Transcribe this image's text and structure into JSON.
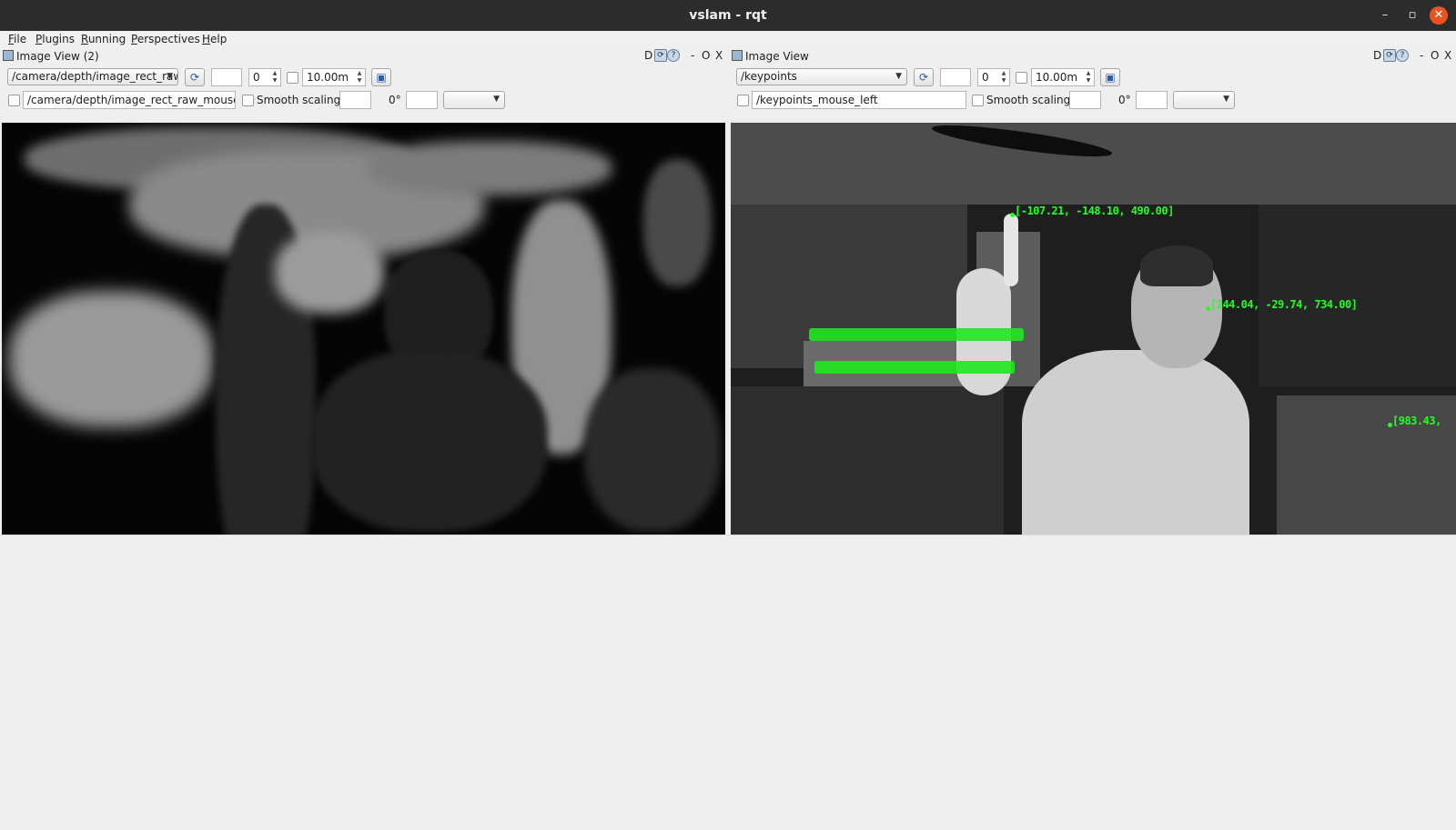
{
  "window": {
    "title": "vslam - rqt",
    "controls": {
      "minimize": "–",
      "maximize": "▫",
      "close": "✕"
    }
  },
  "menu": {
    "items": [
      {
        "label": "File",
        "mnemonic": "F",
        "rest": "ile"
      },
      {
        "label": "Plugins",
        "mnemonic": "P",
        "rest": "lugins"
      },
      {
        "label": "Running",
        "mnemonic": "R",
        "rest": "unning"
      },
      {
        "label": "Perspectives",
        "mnemonic": "P",
        "rest": "erspectives"
      },
      {
        "label": "Help",
        "mnemonic": "H",
        "rest": "elp"
      }
    ]
  },
  "panels": {
    "left": {
      "title": "Image View (2)",
      "controls": {
        "help": "D",
        "minimize": "-",
        "float": "O",
        "close": "X"
      },
      "topic": "/camera/depth/image_rect_raw",
      "value_field": "",
      "spin_value": "0",
      "max_depth": "10.00m",
      "mouse_topic": "/camera/depth/image_rect_raw_mouse_left",
      "smooth_scaling_label": "Smooth scaling",
      "rotation": "0°"
    },
    "right": {
      "title": "Image View",
      "controls": {
        "help": "D",
        "minimize": "-",
        "float": "O",
        "close": "X"
      },
      "topic": "/keypoints",
      "value_field": "",
      "spin_value": "0",
      "max_depth": "10.00m",
      "mouse_topic": "/keypoints_mouse_left",
      "smooth_scaling_label": "Smooth scaling",
      "rotation": "0°",
      "keypoints": [
        "[-107.21, -148.10, 490.00]",
        "[244.04, -29.74, 734.00]",
        "[983.43,"
      ]
    }
  },
  "colors": {
    "titlebar": "#2c2c2c",
    "close_button": "#e95420",
    "keypoint_label": "#22ff22"
  }
}
